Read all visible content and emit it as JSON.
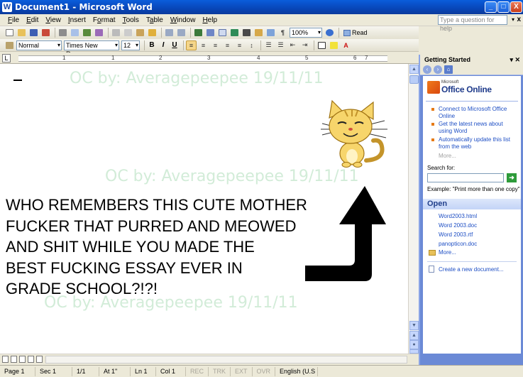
{
  "window": {
    "title": "Document1 - Microsoft Word",
    "minimize": "_",
    "maximize": "□",
    "close": "X"
  },
  "menu": {
    "items": [
      {
        "pre": "",
        "ul": "F",
        "post": "ile"
      },
      {
        "pre": "",
        "ul": "E",
        "post": "dit"
      },
      {
        "pre": "",
        "ul": "V",
        "post": "iew"
      },
      {
        "pre": "",
        "ul": "I",
        "post": "nsert"
      },
      {
        "pre": "F",
        "ul": "o",
        "post": "rmat"
      },
      {
        "pre": "",
        "ul": "T",
        "post": "ools"
      },
      {
        "pre": "T",
        "ul": "a",
        "post": "ble"
      },
      {
        "pre": "",
        "ul": "W",
        "post": "indow"
      },
      {
        "pre": "",
        "ul": "H",
        "post": "elp"
      }
    ],
    "ask_placeholder": "Type a question for help",
    "doc_close": "x"
  },
  "toolbar": {
    "zoom": "100%",
    "read_label": "Read",
    "style": "Normal",
    "font": "Times New Roman",
    "size": "12",
    "bold": "B",
    "italic": "I",
    "underline": "U",
    "font_color_label": "A"
  },
  "ruler": {
    "numbers": [
      "1",
      "1",
      "2",
      "3",
      "4",
      "5",
      "6",
      "7"
    ]
  },
  "document": {
    "watermark": "OC by: Averagepeepee 19/11/11",
    "meme_lines": [
      "WHO REMEMBERS THIS CUTE MOTHER",
      "FUCKER THAT PURRED AND MEOWED",
      "AND SHIT WHILE YOU MADE THE",
      "BEST FUCKING ESSAY EVER IN",
      "GRADE SCHOOL?!?!"
    ],
    "colors": {
      "arrow": "#000000",
      "cat": "#f7d56b",
      "watermark": "#d2ecd8"
    }
  },
  "status": {
    "page": "Page 1",
    "sec": "Sec 1",
    "pages": "1/1",
    "at": "At 1\"",
    "ln": "Ln 1",
    "col": "Col 1",
    "rec": "REC",
    "trk": "TRK",
    "ext": "EXT",
    "ovr": "OVR",
    "lang": "English (U.S"
  },
  "pane": {
    "title": "Getting Started",
    "logo_ms": "Microsoft",
    "logo_name": "Office Online",
    "links": [
      "Connect to Microsoft Office Online",
      "Get the latest news about using Word",
      "Automatically update this list from the web"
    ],
    "more": "More...",
    "search_label": "Search for:",
    "example": "Example: \"Print more than one copy\"",
    "open_title": "Open",
    "files": [
      "Word2003.html",
      "Word 2003.doc",
      "Word 2003.rtf",
      "panopticon.doc"
    ],
    "open_more": "More...",
    "create_new": "Create a new document..."
  }
}
